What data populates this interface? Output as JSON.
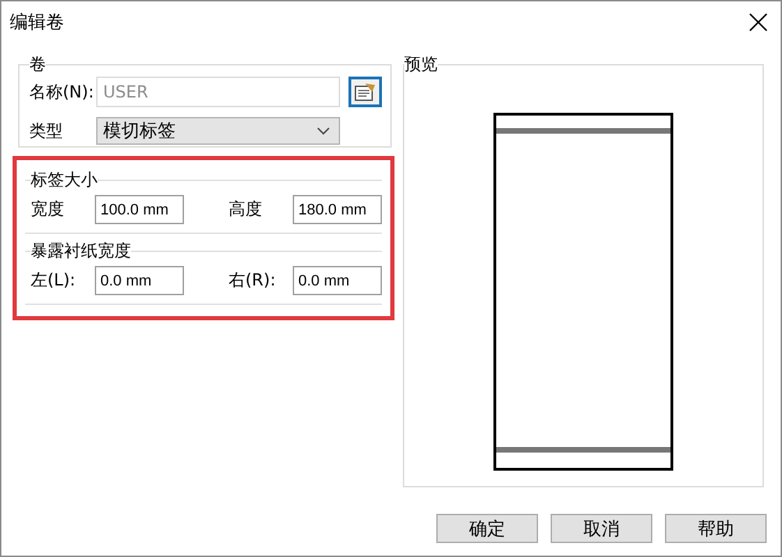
{
  "window": {
    "title": "编辑卷"
  },
  "roll": {
    "legend": "卷",
    "name": {
      "label": "名称(N):",
      "value": "USER",
      "disabled": true
    },
    "type": {
      "label": "类型",
      "value": "模切标签"
    }
  },
  "label_size": {
    "legend": "标签大小",
    "fields": [
      {
        "label": "宽度",
        "value": "100.0 mm"
      },
      {
        "label": "高度",
        "value": "180.0 mm"
      }
    ]
  },
  "liner_width": {
    "legend": "暴露衬纸宽度",
    "fields": [
      {
        "label": "左(L):",
        "value": "0.0 mm"
      },
      {
        "label": "右(R):",
        "value": "0.0 mm"
      }
    ]
  },
  "preview": {
    "legend": "预览"
  },
  "buttons": [
    "确定",
    "取消",
    "帮助"
  ]
}
